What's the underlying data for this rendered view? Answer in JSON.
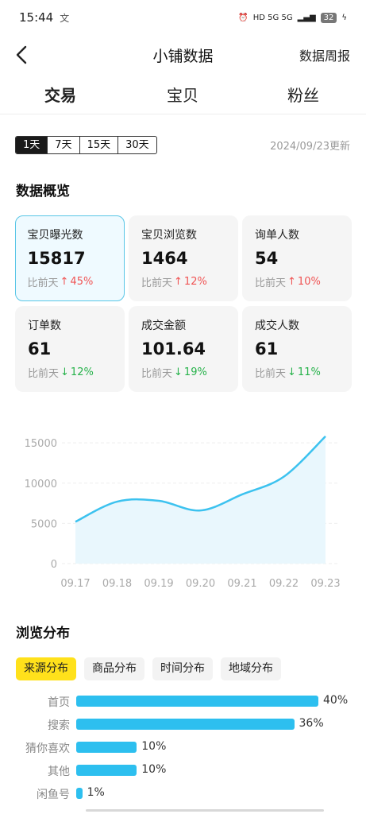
{
  "status": {
    "time": "15:44",
    "time_glyph": "文",
    "network": "HD 5G 5G",
    "battery": "32"
  },
  "nav": {
    "title": "小铺数据",
    "weekly_report": "数据周报"
  },
  "tabs": [
    {
      "label": "交易",
      "active": true
    },
    {
      "label": "宝贝",
      "active": false
    },
    {
      "label": "粉丝",
      "active": false
    }
  ],
  "period": {
    "options": [
      "1天",
      "7天",
      "15天",
      "30天"
    ],
    "selected": "1天",
    "updated": "2024/09/23更新"
  },
  "overview": {
    "title": "数据概览",
    "compare_prefix": "比前天",
    "cards": [
      {
        "label": "宝贝曝光数",
        "value": "15817",
        "change": "45%",
        "direction": "up",
        "active": true
      },
      {
        "label": "宝贝浏览数",
        "value": "1464",
        "change": "12%",
        "direction": "up",
        "active": false
      },
      {
        "label": "询单人数",
        "value": "54",
        "change": "10%",
        "direction": "up",
        "active": false
      },
      {
        "label": "订单数",
        "value": "61",
        "change": "12%",
        "direction": "down",
        "active": false
      },
      {
        "label": "成交金额",
        "value": "101.64",
        "change": "19%",
        "direction": "down",
        "active": false
      },
      {
        "label": "成交人数",
        "value": "61",
        "change": "11%",
        "direction": "down",
        "active": false
      }
    ]
  },
  "chart_data": {
    "type": "area",
    "x": [
      "09.17",
      "09.18",
      "09.19",
      "09.20",
      "09.21",
      "09.22",
      "09.23"
    ],
    "series": [
      {
        "values": [
          5200,
          7700,
          7800,
          6600,
          8600,
          10800,
          15817
        ]
      }
    ],
    "ylim": [
      0,
      16000
    ],
    "yticks": [
      0,
      5000,
      10000,
      15000
    ],
    "grid": true,
    "colors": {
      "line": "#3cc2ef",
      "fill": "#e9f7fd"
    }
  },
  "distribution": {
    "title": "浏览分布",
    "chips": [
      {
        "label": "来源分布",
        "selected": true
      },
      {
        "label": "商品分布",
        "selected": false
      },
      {
        "label": "时间分布",
        "selected": false
      },
      {
        "label": "地域分布",
        "selected": false
      }
    ],
    "rows": [
      {
        "name": "首页",
        "value": 40,
        "label": "40%"
      },
      {
        "name": "搜索",
        "value": 36,
        "label": "36%"
      },
      {
        "name": "猜你喜欢",
        "value": 10,
        "label": "10%"
      },
      {
        "name": "其他",
        "value": 10,
        "label": "10%"
      },
      {
        "name": "闲鱼号",
        "value": 1,
        "label": "1%"
      }
    ],
    "bar_color": "#2dbfef"
  }
}
